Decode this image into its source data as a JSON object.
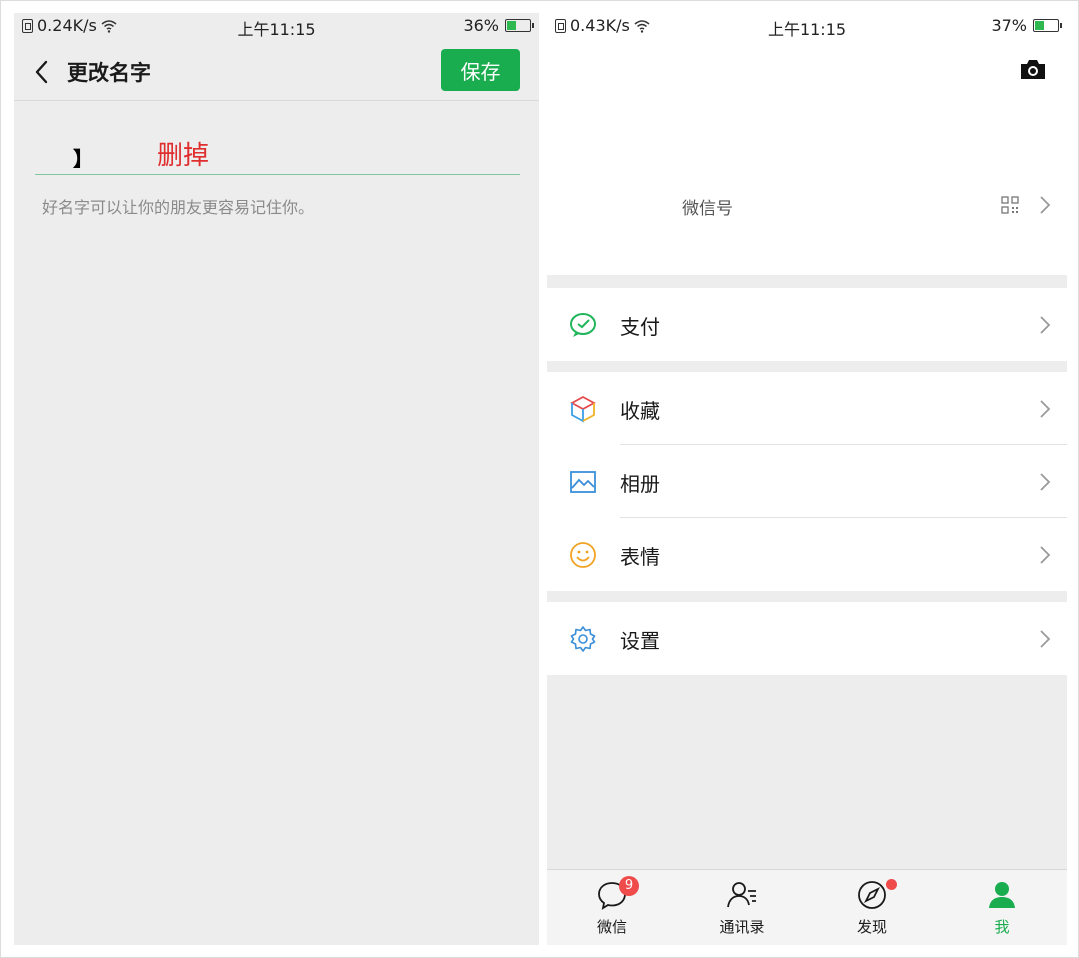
{
  "left_screen": {
    "status_bar": {
      "network_speed": "0.24K/s",
      "time": "上午11:15",
      "battery": "36%",
      "battery_level": 0.36
    },
    "header": {
      "title": "更改名字",
      "save_label": "保存"
    },
    "name_field": {
      "value": "】"
    },
    "annotation": "删掉",
    "hint": "好名字可以让你的朋友更容易记住你。"
  },
  "right_screen": {
    "status_bar": {
      "network_speed": "0.43K/s",
      "time": "上午11:15",
      "battery": "37%",
      "battery_level": 0.37
    },
    "profile": {
      "wechat_id_label": "微信号"
    },
    "menu_groups": [
      {
        "items": [
          {
            "label": "支付",
            "icon": "pay-icon"
          }
        ]
      },
      {
        "items": [
          {
            "label": "收藏",
            "icon": "favorites-icon"
          },
          {
            "label": "相册",
            "icon": "album-icon"
          },
          {
            "label": "表情",
            "icon": "sticker-icon"
          }
        ]
      },
      {
        "items": [
          {
            "label": "设置",
            "icon": "settings-icon"
          }
        ]
      }
    ],
    "tabbar": [
      {
        "label": "微信",
        "icon": "chat-icon",
        "badge": "9",
        "active": false
      },
      {
        "label": "通讯录",
        "icon": "contacts-icon",
        "active": false
      },
      {
        "label": "发现",
        "icon": "discover-icon",
        "dot": true,
        "active": false
      },
      {
        "label": "我",
        "icon": "me-icon",
        "active": true
      }
    ]
  },
  "colors": {
    "accent": "#1aad4f",
    "badge": "#f04b4b",
    "annotation": "#e02d2d"
  }
}
